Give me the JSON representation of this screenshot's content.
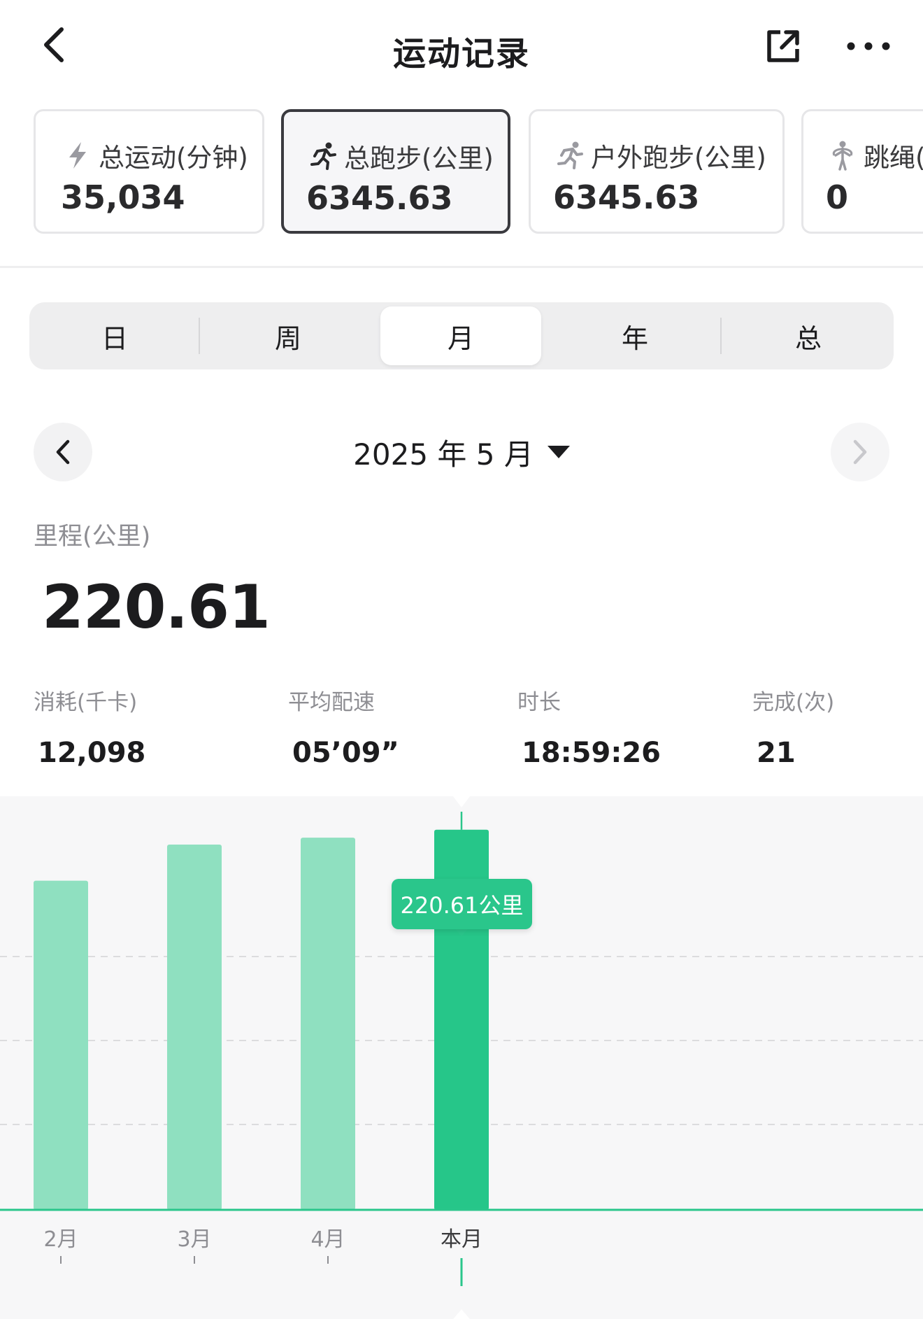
{
  "header": {
    "title": "运动记录",
    "back_icon": "chevron-left-icon",
    "share_icon": "share-external-icon",
    "more_icon": "more-horizontal-icon"
  },
  "cards": [
    {
      "label": "总运动(分钟)",
      "value": "35,034",
      "icon": "lightning-icon",
      "selected": false
    },
    {
      "label": "总跑步(公里)",
      "value": "6345.63",
      "icon": "runner-icon",
      "selected": true
    },
    {
      "label": "户外跑步(公里)",
      "value": "6345.63",
      "icon": "runner-icon",
      "selected": false
    },
    {
      "label": "跳绳(",
      "value": "0",
      "icon": "jump-rope-icon",
      "selected": false
    }
  ],
  "period_tabs": [
    "日",
    "周",
    "月",
    "年",
    "总"
  ],
  "active_period": "月",
  "date_nav": {
    "label": "2025 年 5 月"
  },
  "summary": {
    "metric_label": "里程(公里)",
    "metric_value": "220.61",
    "stats": [
      {
        "label": "消耗(千卡)",
        "value": "12,098"
      },
      {
        "label": "平均配速",
        "value": "05’09”"
      },
      {
        "label": "时长",
        "value": "18:59:26"
      },
      {
        "label": "完成(次)",
        "value": "21"
      }
    ]
  },
  "chart_data": {
    "type": "bar",
    "categories": [
      "2月",
      "3月",
      "4月",
      "本月"
    ],
    "values": [
      191,
      212,
      216,
      220.61
    ],
    "selected_index": 3,
    "tooltip": "220.61公里",
    "unit": "公里",
    "ylim": [
      0,
      240
    ],
    "grid": true,
    "colors": {
      "bar": "#8fe0c0",
      "bar_selected": "#26c689",
      "axis": "#2ac68b",
      "grid": "#dcdcde"
    }
  }
}
